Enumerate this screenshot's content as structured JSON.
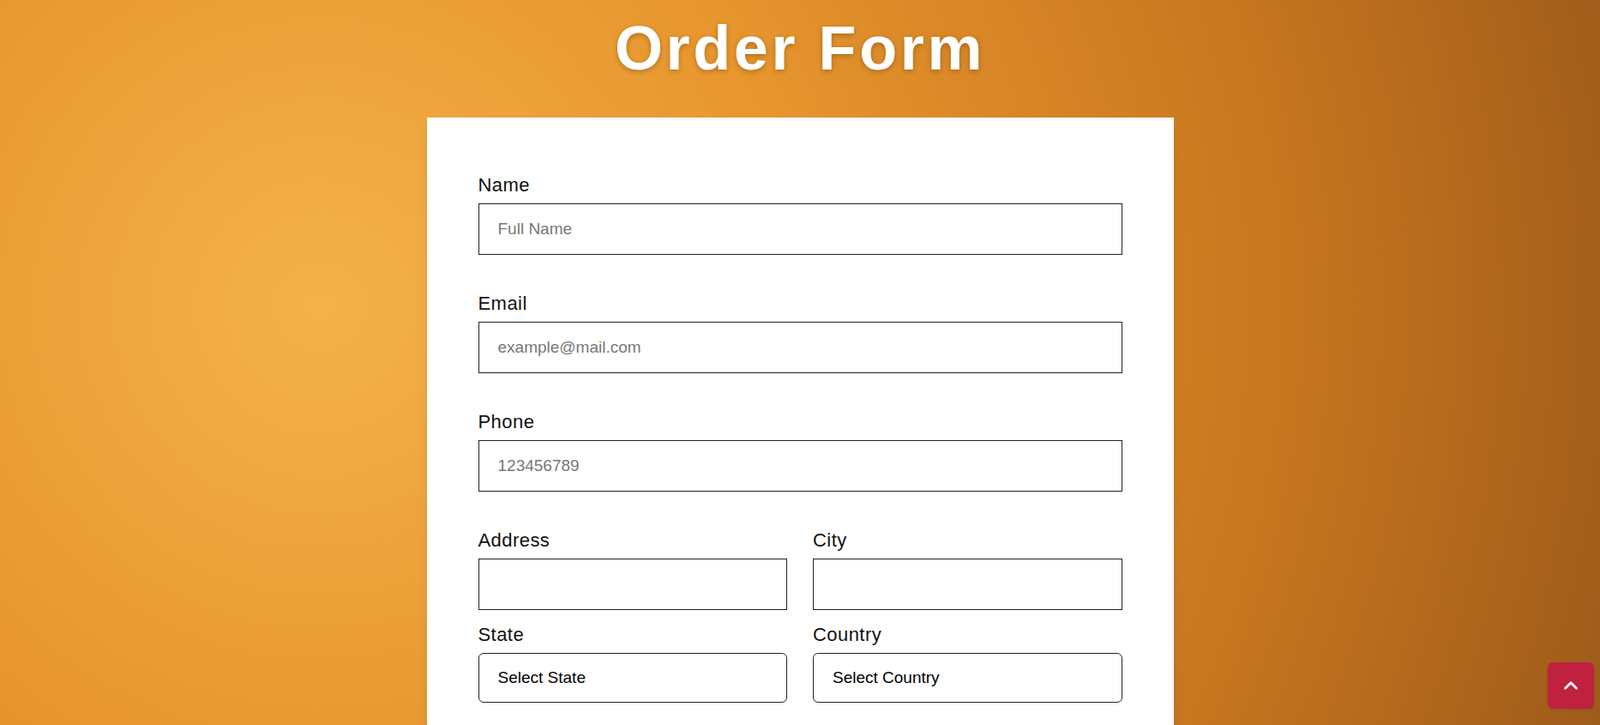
{
  "page": {
    "title": "Order Form"
  },
  "form": {
    "rows": [
      [
        {
          "label": "Name",
          "kind": "text",
          "placeholder": "Full Name",
          "value": ""
        }
      ],
      [
        {
          "label": "Email",
          "kind": "text",
          "placeholder": "example@mail.com",
          "value": ""
        }
      ],
      [
        {
          "label": "Phone",
          "kind": "text",
          "placeholder": "123456789",
          "value": ""
        }
      ],
      [
        {
          "label": "Address",
          "kind": "text",
          "placeholder": "",
          "value": ""
        },
        {
          "label": "City",
          "kind": "text",
          "placeholder": "",
          "value": ""
        }
      ],
      [
        {
          "label": "State",
          "kind": "select",
          "placeholder": "",
          "value": "Select State"
        },
        {
          "label": "Country",
          "kind": "select",
          "placeholder": "",
          "value": "Select Country"
        }
      ]
    ]
  },
  "scroll_top_button": {
    "visible": true
  }
}
